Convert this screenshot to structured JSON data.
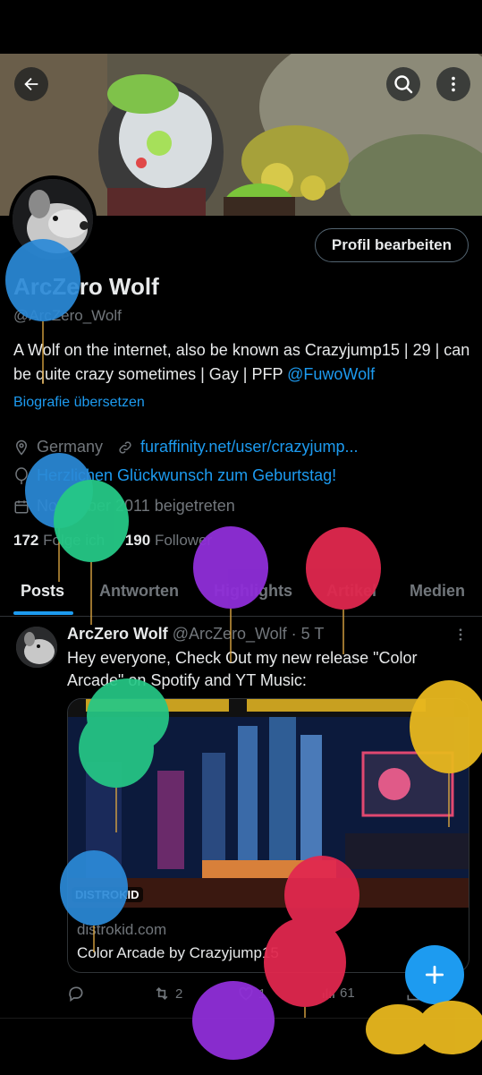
{
  "profile": {
    "name": "ArcZero Wolf",
    "handle": "@ArcZero_Wolf",
    "bio_text": "A Wolf on the internet, also be known as Crazyjump15 | 29 | can be quite crazy sometimes | Gay | PFP ",
    "bio_mention": "@FuwoWolf",
    "translate_label": "Biografie übersetzen",
    "location": "Germany",
    "website": "furaffinity.net/user/crazyjump...",
    "birthday": "Herzlichen Glückwunsch zum Geburtstag!",
    "joined": "November 2011 beigetreten",
    "following_count": "172",
    "following_label": "Folge ich",
    "followers_count": "190",
    "followers_label": "Follower",
    "edit_button": "Profil bearbeiten"
  },
  "tabs": [
    {
      "label": "Posts",
      "active": true
    },
    {
      "label": "Antworten"
    },
    {
      "label": "Highlights"
    },
    {
      "label": "Artikel"
    },
    {
      "label": "Medien"
    }
  ],
  "post": {
    "author": "ArcZero Wolf",
    "handle_time": "@ArcZero_Wolf · 5 T",
    "text": "Hey everyone, Check Out my new release \"Color Arcade\" on Spotify and YT Music:",
    "card_badge": "DISTROKID",
    "card_domain": "distrokid.com",
    "card_title": "Color Arcade by Crazyjump15",
    "retweets": "2",
    "likes": "1",
    "views": "61"
  },
  "icons": [
    "back-arrow-icon",
    "search-icon",
    "more-vertical-icon",
    "location-icon",
    "link-icon",
    "balloon-icon",
    "calendar-icon",
    "reply-icon",
    "retweet-icon",
    "like-icon",
    "views-icon",
    "share-icon",
    "plus-icon"
  ],
  "colors": {
    "accent": "#1d9bf0",
    "background": "#000000",
    "muted": "#71767b",
    "text": "#e7e9ea"
  }
}
